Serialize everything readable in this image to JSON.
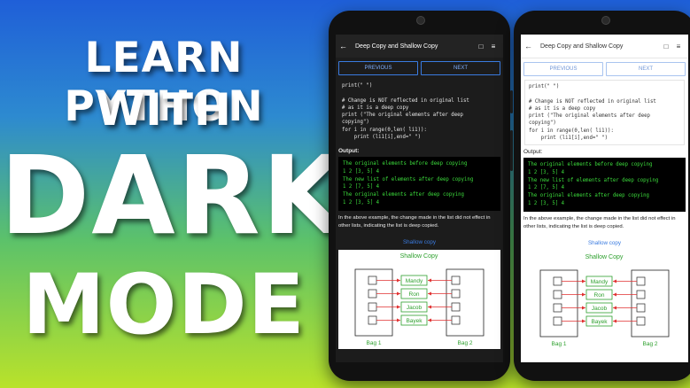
{
  "headline": {
    "line1": "LEARN PYTHON",
    "line2": "WITH",
    "line3": "DARK",
    "line4": "MODE"
  },
  "screen": {
    "title": "Deep Copy and Shallow Copy",
    "back_icon": "arrow-left-icon",
    "bookmark_icon": "bookmark-icon",
    "settings_icon": "sliders-icon",
    "prev_label": "PREVIOUS",
    "next_label": "NEXT",
    "code": "print(\" \")\n\n# Change is NOT reflected in original list\n# as it is a deep copy\nprint (\"The original elements after deep\ncopying\")\nfor i in range(0,len( li1)):\n    print (li1[i],end=\" \")",
    "code_light": "print(\" \")\n\n# Change is NOT reflected in original list\n# as it is a deep copy\nprint (\"The original elements after deep\ncopying\")\nfor i in range(0,len( li1)):\n    print (li1[i],end=\" \")",
    "output_label": "Output:",
    "output": "The original elements before deep copying\n1 2 [3, 5] 4\nThe new list of elements after deep copying\n1 2 [7, 5] 4\nThe original elements after deep copying\n1 2 [3, 5] 4",
    "description": "In the above example, the change made in the list did not effect in other lists, indicating the list is deep copied.",
    "section_title": "Shallow copy",
    "diagram": {
      "title": "Shallow Copy",
      "items": [
        "Mandy",
        "Ron",
        "Jacob",
        "Bayek"
      ],
      "bag1": "Bag 1",
      "bag2": "Bag 2"
    }
  },
  "colors": {
    "accent": "#3a7be0",
    "terminal_green": "#3cdc3c",
    "diagram_green": "#2ea02e",
    "arrow_red": "#e03030"
  }
}
